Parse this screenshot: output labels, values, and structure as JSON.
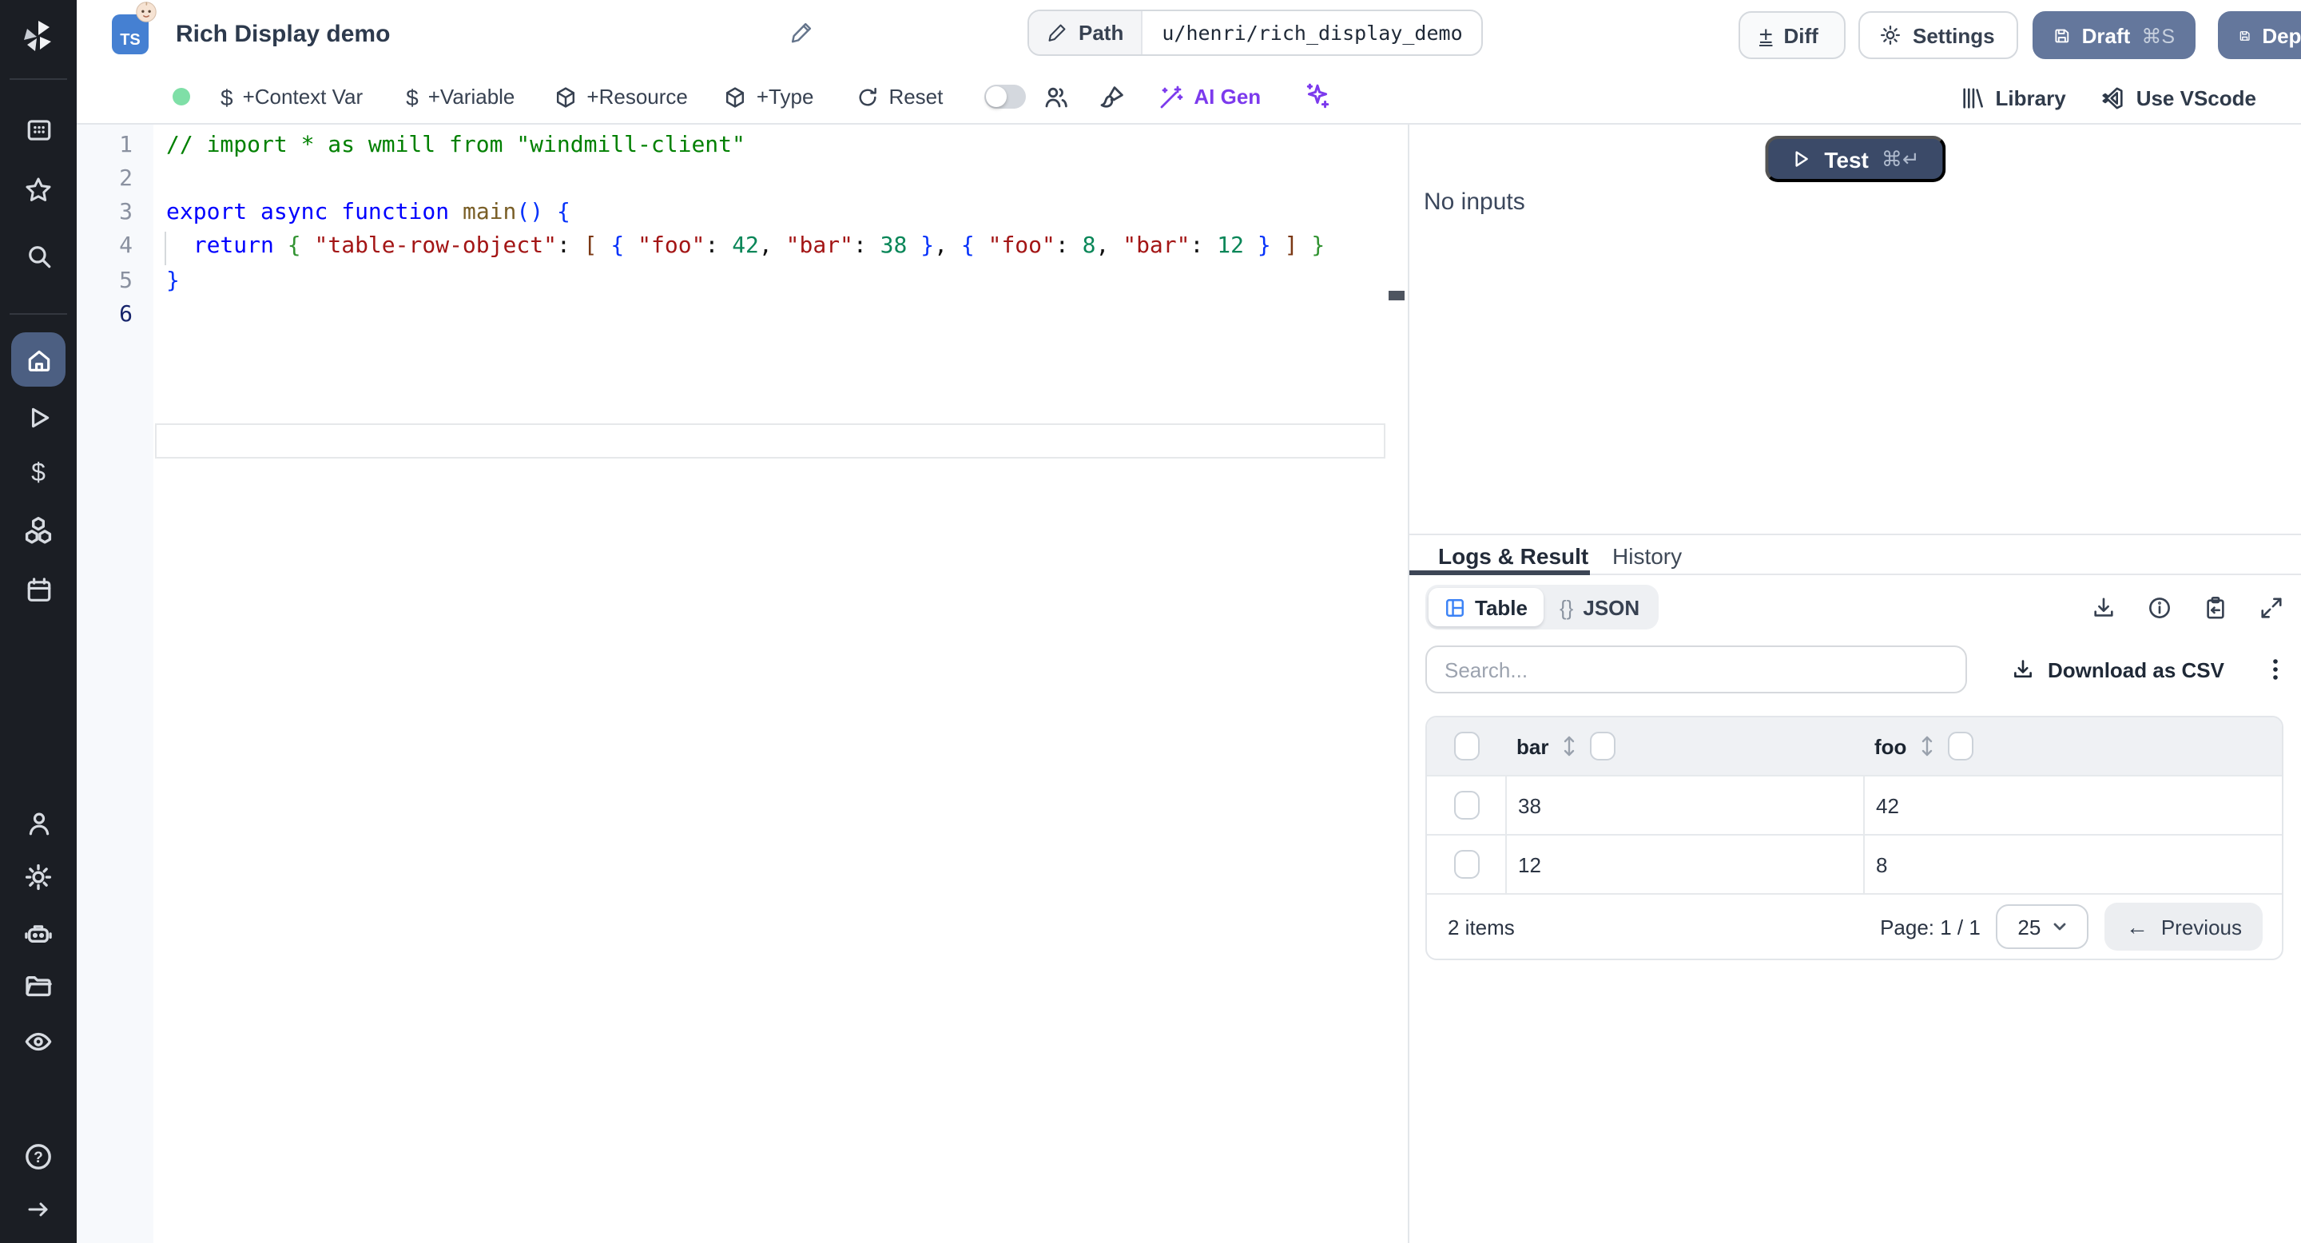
{
  "app": {
    "topbar": {
      "language_badge": "TS",
      "title": "Rich Display demo",
      "path_label": "Path",
      "path_value": "u/henri/rich_display_demo",
      "diff_icon_glyph": "±",
      "diff_label": "Diff",
      "settings_label": "Settings",
      "draft_label": "Draft",
      "draft_shortcut": "⌘S",
      "deploy_label": "Deploy"
    },
    "toolbar": {
      "dollar_glyph": "$",
      "context_var_label": "+Context Var",
      "variable_label": "+Variable",
      "resource_label": "+Resource",
      "type_label": "+Type",
      "reset_label": "Reset",
      "ai_gen_label": "AI Gen",
      "library_label": "Library",
      "use_vscode_label": "Use VScode"
    },
    "editor": {
      "active_line": "6",
      "lines": [
        {
          "num": "1",
          "tokens": [
            [
              "cmt",
              "// import * as wmill from \"windmill-client\""
            ]
          ]
        },
        {
          "num": "2",
          "tokens": []
        },
        {
          "num": "3",
          "tokens": [
            [
              "k",
              "export"
            ],
            [
              "pl",
              " "
            ],
            [
              "k",
              "async"
            ],
            [
              "pl",
              " "
            ],
            [
              "k",
              "function"
            ],
            [
              "pl",
              " "
            ],
            [
              "fn",
              "main"
            ],
            [
              "b1",
              "()"
            ],
            [
              "pl",
              " "
            ],
            [
              "b1",
              "{"
            ]
          ]
        },
        {
          "num": "4",
          "tokens": [
            [
              "pl",
              "  "
            ],
            [
              "k",
              "return"
            ],
            [
              "pl",
              " "
            ],
            [
              "b2",
              "{"
            ],
            [
              "pl",
              " "
            ],
            [
              "str",
              "\"table-row-object\""
            ],
            [
              "pl",
              ": "
            ],
            [
              "b3",
              "["
            ],
            [
              "pl",
              " "
            ],
            [
              "b1",
              "{"
            ],
            [
              "pl",
              " "
            ],
            [
              "str",
              "\"foo\""
            ],
            [
              "pl",
              ": "
            ],
            [
              "num",
              "42"
            ],
            [
              "pl",
              ", "
            ],
            [
              "str",
              "\"bar\""
            ],
            [
              "pl",
              ": "
            ],
            [
              "num",
              "38"
            ],
            [
              "pl",
              " "
            ],
            [
              "b1",
              "}"
            ],
            [
              "pl",
              ", "
            ],
            [
              "b1",
              "{"
            ],
            [
              "pl",
              " "
            ],
            [
              "str",
              "\"foo\""
            ],
            [
              "pl",
              ": "
            ],
            [
              "num",
              "8"
            ],
            [
              "pl",
              ", "
            ],
            [
              "str",
              "\"bar\""
            ],
            [
              "pl",
              ": "
            ],
            [
              "num",
              "12"
            ],
            [
              "pl",
              " "
            ],
            [
              "b1",
              "}"
            ],
            [
              "pl",
              " "
            ],
            [
              "b3",
              "]"
            ],
            [
              "pl",
              " "
            ],
            [
              "b2",
              "}"
            ]
          ]
        },
        {
          "num": "5",
          "tokens": [
            [
              "b1",
              "}"
            ]
          ]
        },
        {
          "num": "6",
          "tokens": []
        }
      ]
    },
    "run_panel": {
      "test_label": "Test",
      "test_shortcut": "⌘↵",
      "no_inputs": "No inputs"
    },
    "result_panel": {
      "tabs": [
        {
          "label": "Logs & Result"
        },
        {
          "label": "History"
        }
      ],
      "view_toggle": {
        "table_label": "Table",
        "json_glyph": "{}",
        "json_label": "JSON"
      },
      "search_placeholder": "Search...",
      "download_csv_label": "Download as CSV",
      "table": {
        "columns": [
          "bar",
          "foo"
        ],
        "rows": [
          [
            "38",
            "42"
          ],
          [
            "12",
            "8"
          ]
        ],
        "items_count": "2 items",
        "page_label": "Page: 1 / 1",
        "page_size": "25",
        "prev_arrow": "←",
        "prev_label": "Previous"
      }
    },
    "sidebar": {
      "help_glyph": "?",
      "dollar_glyph": "$"
    },
    "colors": {
      "rail_bg": "#1b1e24",
      "accent_slate": "#64779c",
      "test_navy": "#3b4a68",
      "active_item": "#4c5f82",
      "ai_violet": "#7c3aed",
      "table_icon_blue": "#3b82f6",
      "status_green": "#7fdfa7",
      "ts_blue": "#4580d2"
    }
  }
}
